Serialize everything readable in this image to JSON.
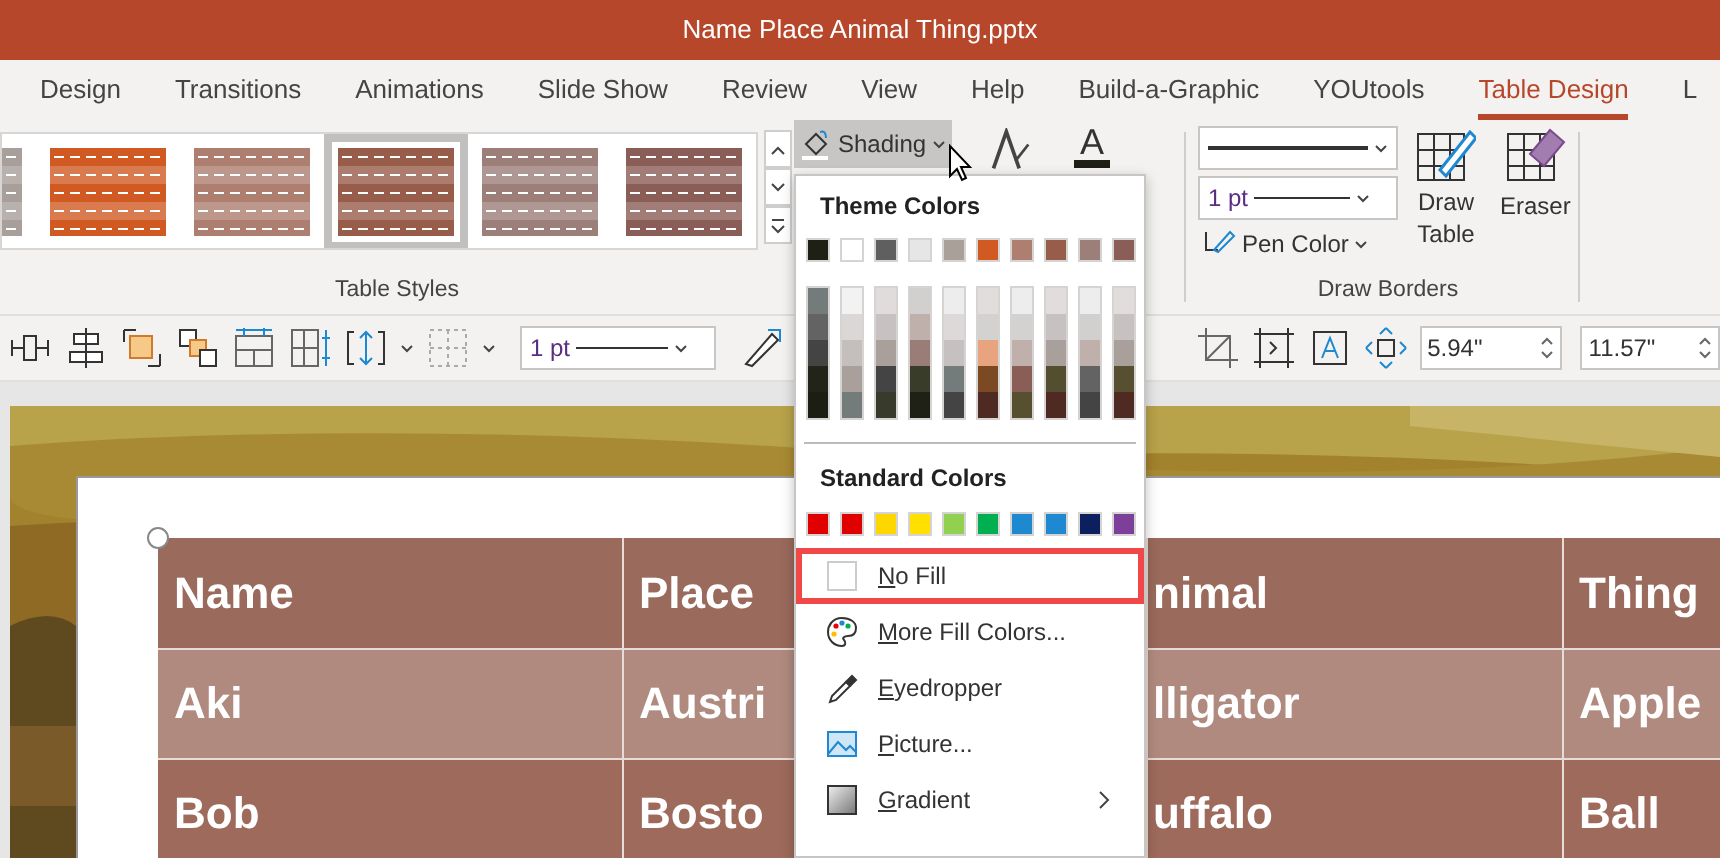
{
  "window": {
    "title": "Name Place Animal Thing.pptx"
  },
  "tabs": [
    {
      "label": "Design",
      "selected": false
    },
    {
      "label": "Transitions",
      "selected": false
    },
    {
      "label": "Animations",
      "selected": false
    },
    {
      "label": "Slide Show",
      "selected": false
    },
    {
      "label": "Review",
      "selected": false
    },
    {
      "label": "View",
      "selected": false
    },
    {
      "label": "Help",
      "selected": false
    },
    {
      "label": "Build-a-Graphic",
      "selected": false
    },
    {
      "label": "YOUtools",
      "selected": false
    },
    {
      "label": "Table Design",
      "selected": true
    },
    {
      "label": "L",
      "selected": false
    }
  ],
  "table_styles": {
    "label": "Table Styles",
    "items": [
      {
        "color": "#a89e9a",
        "selected": false
      },
      {
        "color": "#d05a22",
        "selected": false
      },
      {
        "color": "#ae7e70",
        "selected": false
      },
      {
        "color": "#985c4a",
        "selected": true
      },
      {
        "color": "#9c7f78",
        "selected": false
      },
      {
        "color": "#8b5d57",
        "selected": false
      }
    ]
  },
  "shading": {
    "label": "Shading",
    "expanded": true
  },
  "font_color": {
    "label": "A"
  },
  "draw_borders": {
    "label": "Draw Borders",
    "pen_weight": "1 pt",
    "pen_color": "Pen Color",
    "draw_table": "Draw Table",
    "eraser": "Eraser"
  },
  "toolbar": {
    "border_weight": "1 pt",
    "height": "5.94\"",
    "width": "11.57\""
  },
  "shading_menu": {
    "theme_title": "Theme Colors",
    "theme_colors": [
      {
        "color": "#1e2016"
      },
      {
        "color": "#ffffff"
      },
      {
        "color": "#5f5f5f"
      },
      {
        "color": "#e6e6e6"
      },
      {
        "color": "#a9a09a"
      },
      {
        "color": "#d05a22"
      },
      {
        "color": "#ae7e70"
      },
      {
        "color": "#985c4a"
      },
      {
        "color": "#9c7f78"
      },
      {
        "color": "#8b5d57"
      }
    ],
    "shades": [
      {
        "colors": [
          {
            "color": "#737b7b"
          },
          {
            "color": "#636363"
          },
          {
            "color": "#444444"
          },
          {
            "color": "#22241a"
          },
          {
            "color": "#1c1e14"
          }
        ]
      },
      {
        "colors": [
          {
            "color": "#f2f2f2"
          },
          {
            "color": "#dbd7d6"
          },
          {
            "color": "#c4bebc"
          },
          {
            "color": "#aaa09b"
          },
          {
            "color": "#737b7b"
          }
        ]
      },
      {
        "colors": [
          {
            "color": "#e0dcdb"
          },
          {
            "color": "#c7c2c1"
          },
          {
            "color": "#a9a09c"
          },
          {
            "color": "#444444"
          },
          {
            "color": "#383b2b"
          }
        ]
      },
      {
        "colors": [
          {
            "color": "#d2d0cf"
          },
          {
            "color": "#bfb0ab"
          },
          {
            "color": "#9b7d77"
          },
          {
            "color": "#3a3c2a"
          },
          {
            "color": "#1f2116"
          }
        ]
      },
      {
        "colors": [
          {
            "color": "#eeeded"
          },
          {
            "color": "#dcd9d8"
          },
          {
            "color": "#c6c1c0"
          },
          {
            "color": "#737b7b"
          },
          {
            "color": "#444444"
          }
        ]
      },
      {
        "colors": [
          {
            "color": "#e0dddc"
          },
          {
            "color": "#d4d2d1"
          },
          {
            "color": "#e8a37f"
          },
          {
            "color": "#7b4a22"
          },
          {
            "color": "#4e2a22"
          }
        ]
      },
      {
        "colors": [
          {
            "color": "#ededed"
          },
          {
            "color": "#d4d2d1"
          },
          {
            "color": "#bfb0ab"
          },
          {
            "color": "#8b5d57"
          },
          {
            "color": "#575030"
          }
        ]
      },
      {
        "colors": [
          {
            "color": "#e0dddc"
          },
          {
            "color": "#c7c2c1"
          },
          {
            "color": "#aaa09b"
          },
          {
            "color": "#534e30"
          },
          {
            "color": "#4e2a22"
          }
        ]
      },
      {
        "colors": [
          {
            "color": "#eeeded"
          },
          {
            "color": "#d2d0cf"
          },
          {
            "color": "#bfb0ab"
          },
          {
            "color": "#636363"
          },
          {
            "color": "#444444"
          }
        ]
      },
      {
        "colors": [
          {
            "color": "#e0dddc"
          },
          {
            "color": "#c7c2c1"
          },
          {
            "color": "#aaa09b"
          },
          {
            "color": "#575030"
          },
          {
            "color": "#4e2a22"
          }
        ]
      }
    ],
    "standard_title": "Standard Colors",
    "standard_colors": [
      {
        "color": "#e00000"
      },
      {
        "color": "#e00000"
      },
      {
        "color": "#ffd700"
      },
      {
        "color": "#ffe000"
      },
      {
        "color": "#92d050"
      },
      {
        "color": "#00b050"
      },
      {
        "color": "#1e88d0"
      },
      {
        "color": "#1e88d0"
      },
      {
        "color": "#0c2060"
      },
      {
        "color": "#7c3f9a"
      }
    ],
    "items": [
      {
        "kind": "no-fill",
        "label": "No Fill",
        "outlined": true,
        "has_submenu": false
      },
      {
        "kind": "palette",
        "label": "More Fill Colors...",
        "outlined": false,
        "has_submenu": false
      },
      {
        "kind": "eyedropper",
        "label": "Eyedropper",
        "outlined": false,
        "has_submenu": false
      },
      {
        "kind": "picture",
        "label": "Picture...",
        "outlined": false,
        "has_submenu": false
      },
      {
        "kind": "gradient",
        "label": "Gradient",
        "outlined": false,
        "has_submenu": true
      }
    ]
  },
  "slide_table": {
    "rows": [
      {
        "cells": [
          "Name",
          "Place",
          "nimal",
          "Thing"
        ]
      },
      {
        "cells": [
          "Aki",
          "Austri",
          "lligator",
          "Apple"
        ]
      },
      {
        "cells": [
          "Bob",
          "Bosto",
          "uffalo",
          "Ball"
        ]
      }
    ]
  }
}
